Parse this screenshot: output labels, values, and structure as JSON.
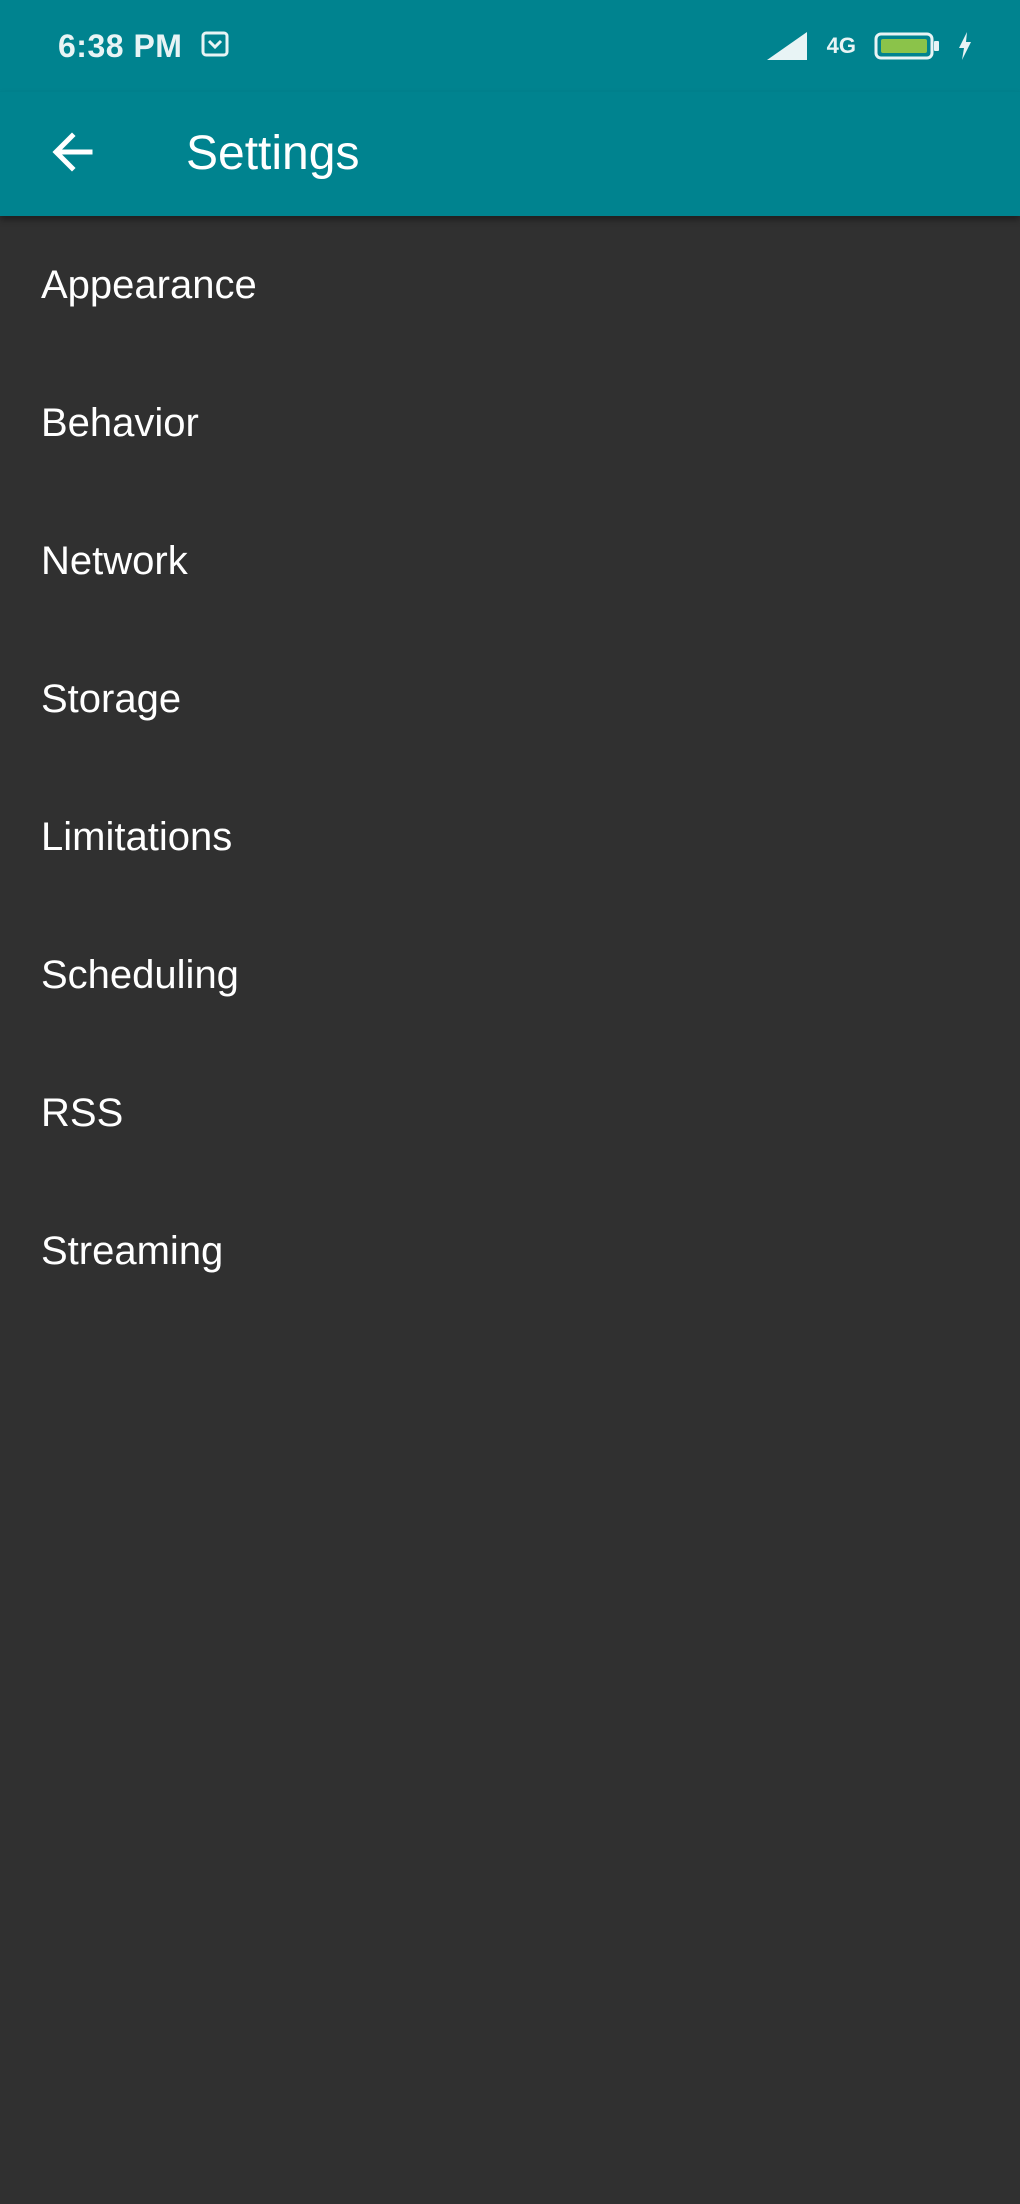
{
  "status_bar": {
    "time": "6:38 PM",
    "network_type": "4G",
    "icons": [
      "notification-icon",
      "signal-icon",
      "network-type-icon",
      "battery-icon",
      "charging-icon"
    ]
  },
  "app_bar": {
    "title": "Settings",
    "back_icon": "arrow-back-icon"
  },
  "settings": {
    "items": [
      {
        "label": "Appearance"
      },
      {
        "label": "Behavior"
      },
      {
        "label": "Network"
      },
      {
        "label": "Storage"
      },
      {
        "label": "Limitations"
      },
      {
        "label": "Scheduling"
      },
      {
        "label": "RSS"
      },
      {
        "label": "Streaming"
      }
    ]
  },
  "colors": {
    "primary": "#00838f",
    "background": "#303030",
    "text": "#ffffff",
    "battery": "#8bc34a"
  }
}
